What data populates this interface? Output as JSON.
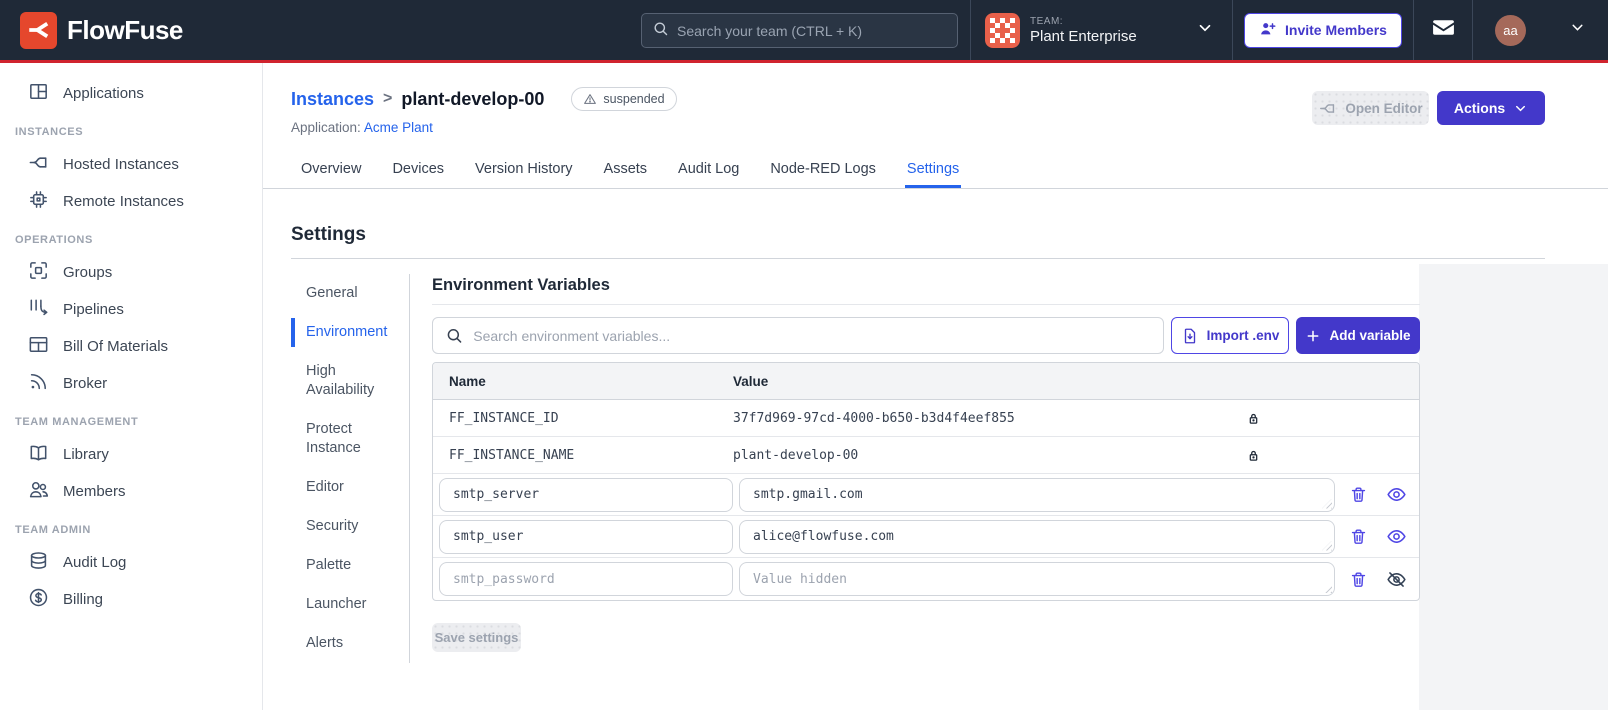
{
  "brand": {
    "name": "FlowFuse",
    "logo_color": "#E5472D",
    "accent_red": "#D0232E"
  },
  "navbar": {
    "search_placeholder": "Search your team (CTRL + K)",
    "team_label": "TEAM:",
    "team_name": "Plant Enterprise",
    "invite_label": "Invite Members",
    "user_initials": "aa"
  },
  "sidebar": {
    "sections": [
      {
        "header": "",
        "items": [
          {
            "label": "Applications",
            "icon": "applications-icon"
          }
        ]
      },
      {
        "header": "INSTANCES",
        "items": [
          {
            "label": "Hosted Instances",
            "icon": "hosted-instances-icon"
          },
          {
            "label": "Remote Instances",
            "icon": "remote-instances-icon"
          }
        ]
      },
      {
        "header": "OPERATIONS",
        "items": [
          {
            "label": "Groups",
            "icon": "groups-icon"
          },
          {
            "label": "Pipelines",
            "icon": "pipelines-icon"
          },
          {
            "label": "Bill Of Materials",
            "icon": "bill-of-materials-icon"
          },
          {
            "label": "Broker",
            "icon": "broker-icon"
          }
        ]
      },
      {
        "header": "TEAM MANAGEMENT",
        "items": [
          {
            "label": "Library",
            "icon": "library-icon"
          },
          {
            "label": "Members",
            "icon": "members-icon"
          }
        ]
      },
      {
        "header": "TEAM ADMIN",
        "items": [
          {
            "label": "Audit Log",
            "icon": "audit-log-icon"
          },
          {
            "label": "Billing",
            "icon": "billing-icon"
          }
        ]
      }
    ]
  },
  "page_header": {
    "breadcrumb_parent": "Instances",
    "breadcrumb_separator": ">",
    "instance_name": "plant-develop-00",
    "status_badge": "suspended",
    "application_label": "Application:",
    "application_name": "Acme Plant",
    "open_editor_label": "Open Editor",
    "actions_label": "Actions"
  },
  "tabs": {
    "items": [
      "Overview",
      "Devices",
      "Version History",
      "Assets",
      "Audit Log",
      "Node-RED Logs",
      "Settings"
    ],
    "active": "Settings"
  },
  "settings": {
    "title": "Settings",
    "nav": {
      "items": [
        "General",
        "Environment",
        "High Availability",
        "Protect Instance",
        "Editor",
        "Security",
        "Palette",
        "Launcher",
        "Alerts"
      ],
      "active": "Environment"
    },
    "panel": {
      "title": "Environment Variables",
      "search_placeholder": "Search environment variables...",
      "import_label": "Import .env",
      "add_label": "Add variable",
      "save_label": "Save settings",
      "table": {
        "columns": [
          "Name",
          "Value"
        ],
        "rows": [
          {
            "name": "FF_INSTANCE_ID",
            "value": "37f7d969-97cd-4000-b650-b3d4f4eef855",
            "locked": true
          },
          {
            "name": "FF_INSTANCE_NAME",
            "value": "plant-develop-00",
            "locked": true
          },
          {
            "name": "smtp_server",
            "value": "smtp.gmail.com",
            "locked": false,
            "hidden": false
          },
          {
            "name": "smtp_user",
            "value": "alice@flowfuse.com",
            "locked": false,
            "hidden": false
          },
          {
            "name": "smtp_password",
            "value": "",
            "value_placeholder": "Value hidden",
            "locked": false,
            "hidden": true
          }
        ]
      }
    }
  },
  "colors": {
    "primary_indigo": "#4338CA",
    "link_blue": "#2563EB"
  }
}
